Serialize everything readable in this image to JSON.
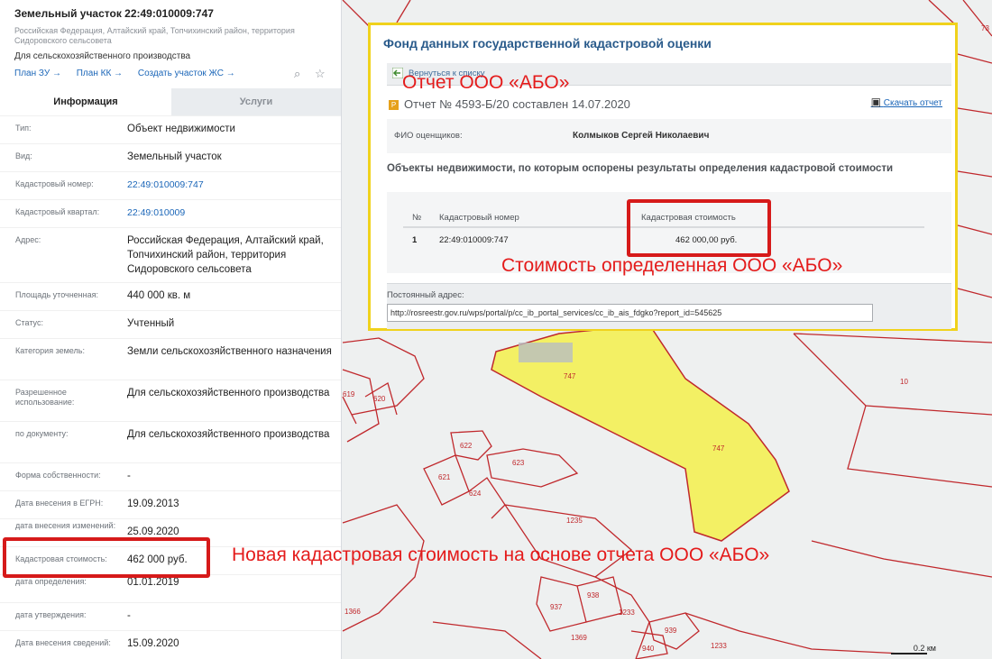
{
  "sidebar": {
    "title": "Земельный участок 22:49:010009:747",
    "address_small": "Российская Федерация, Алтайский край, Топчихинский район, территория Сидоровского сельсовета",
    "purpose": "Для сельскохозяйственного производства",
    "links": [
      "План ЗУ →",
      "План КК →",
      "Создать участок ЖС →"
    ],
    "icons": [
      "find-on-map-icon",
      "star-icon"
    ],
    "tabs": [
      "Информация",
      "Услуги"
    ],
    "rows": [
      {
        "k": "Тип:",
        "v": "Объект недвижимости"
      },
      {
        "k": "Вид:",
        "v": "Земельный участок"
      },
      {
        "k": "Кадастровый номер:",
        "v": "22:49:010009:747"
      },
      {
        "k": "Кадастровый квартал:",
        "v": "22:49:010009"
      },
      {
        "k": "Адрес:",
        "v": "Российская Федерация, Алтайский край, Топчихинский район, территория Сидоровского сельсовета"
      },
      {
        "k": "Площадь уточненная:",
        "v": "440 000 кв. м"
      },
      {
        "k": "Статус:",
        "v": "Учтенный"
      },
      {
        "k": "Категория земель:",
        "v": "Земли сельскохозяйственного назначения"
      },
      {
        "k": "Разрешенное использование:",
        "v": "Для сельскохозяйственного производства"
      },
      {
        "k": "по документу:",
        "v": "Для сельскохозяйственного производства"
      },
      {
        "k": "Форма собственности:",
        "v": "-"
      },
      {
        "k": "Дата внесения в ЕГРН:",
        "v": "19.09.2013"
      },
      {
        "k": "дата внесения изменений:",
        "v": "25.09.2020"
      },
      {
        "k": "Кадастровая стоимость:",
        "v": "462 000 руб."
      },
      {
        "k": "дата определения:",
        "v": "01.01.2019"
      },
      {
        "k": "дата утверждения:",
        "v": "-"
      },
      {
        "k": "Дата внесения сведений:",
        "v": "15.09.2020"
      }
    ]
  },
  "popup": {
    "title": "Фонд данных государственной кадастровой оценки",
    "back_label": "Вернуться к списку",
    "report_badge": "P",
    "report_title": "Отчет № 4593-Б/20 составлен 14.07.2020",
    "download_label": "Скачать отчет",
    "fio_label": "ФИО оценщиков:",
    "fio_value": "Колмыков Сергей Николаевич",
    "objects_heading": "Объекты недвижимости, по которым оспорены результаты определения кадастровой стоимости",
    "table": {
      "headers": [
        "№",
        "Кадастровый номер",
        "Кадастровая стоимость"
      ],
      "row": [
        "1",
        "22:49:010009:747",
        "462 000,00 руб."
      ]
    },
    "permanent_label": "Постоянный адрес:",
    "permanent_url": "http://rosreestr.gov.ru/wps/portal/p/cc_ib_portal_services/cc_ib_ais_fdgko?report_id=545625"
  },
  "annotations": {
    "report": "Отчет ООО «АБО»",
    "cost": "Стоимость определенная ООО «АБО»",
    "new_cost": "Новая кадастровая стоимость на основе отчета ООО «АБО»"
  },
  "map": {
    "labels": [
      "747",
      "747",
      "10",
      "619",
      "620",
      "622",
      "623",
      "621",
      "624",
      "1235",
      "1366",
      "937",
      "938",
      "1233",
      "939",
      "1369",
      "940",
      "1233",
      "73"
    ],
    "scale": "0.2 км"
  },
  "colors": {
    "annotation_red": "#e41b1b",
    "parcel_fill": "#f4f036",
    "boundary": "#c0282c",
    "popup_border": "#f0d21c",
    "link_blue": "#1b66b8"
  }
}
